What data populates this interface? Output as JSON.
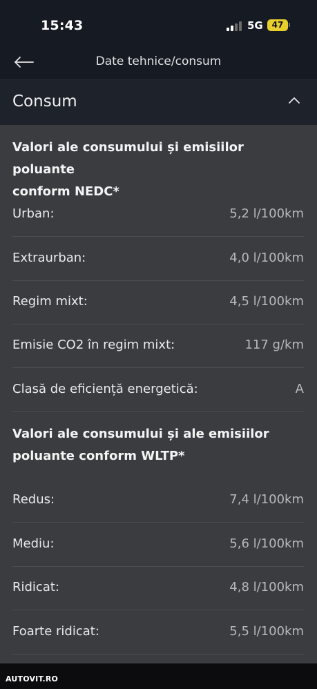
{
  "status_bar": {
    "time": "15:43",
    "network": "5G",
    "battery": "47"
  },
  "header": {
    "title": "Date tehnice/consum"
  },
  "section": {
    "title": "Consum"
  },
  "nedc": {
    "heading_line1": "Valori ale consumului și emisiilor poluante",
    "heading_line2": "conform NEDC*",
    "rows": [
      {
        "label": "Urban:",
        "value": "5,2 l/100km"
      },
      {
        "label": "Extraurban:",
        "value": "4,0 l/100km"
      },
      {
        "label": "Regim mixt:",
        "value": "4,5 l/100km"
      },
      {
        "label": "Emisie CO2 în regim mixt:",
        "value": "117 g/km"
      },
      {
        "label": "Clasă de eficiență energetică:",
        "value": "A"
      }
    ]
  },
  "wltp": {
    "heading_line1": "Valori ale consumului și ale emisiilor",
    "heading_line2": "poluante conform WLTP*",
    "rows": [
      {
        "label": "Redus:",
        "value": "7,4 l/100km"
      },
      {
        "label": "Mediu:",
        "value": "5,6 l/100km"
      },
      {
        "label": "Ridicat:",
        "value": "4,8 l/100km"
      },
      {
        "label": "Foarte ridicat:",
        "value": "5,5 l/100km"
      }
    ]
  },
  "footer": {
    "logo": "AUTOVIT.RO"
  },
  "colors": {
    "accent_battery": "#e8cf2e",
    "background": "#3a3c40",
    "header_bg": "#161a22"
  },
  "icons": {
    "back": "arrow-left-icon",
    "collapse": "chevron-up-icon",
    "signal": "signal-icon",
    "battery": "battery-icon"
  }
}
